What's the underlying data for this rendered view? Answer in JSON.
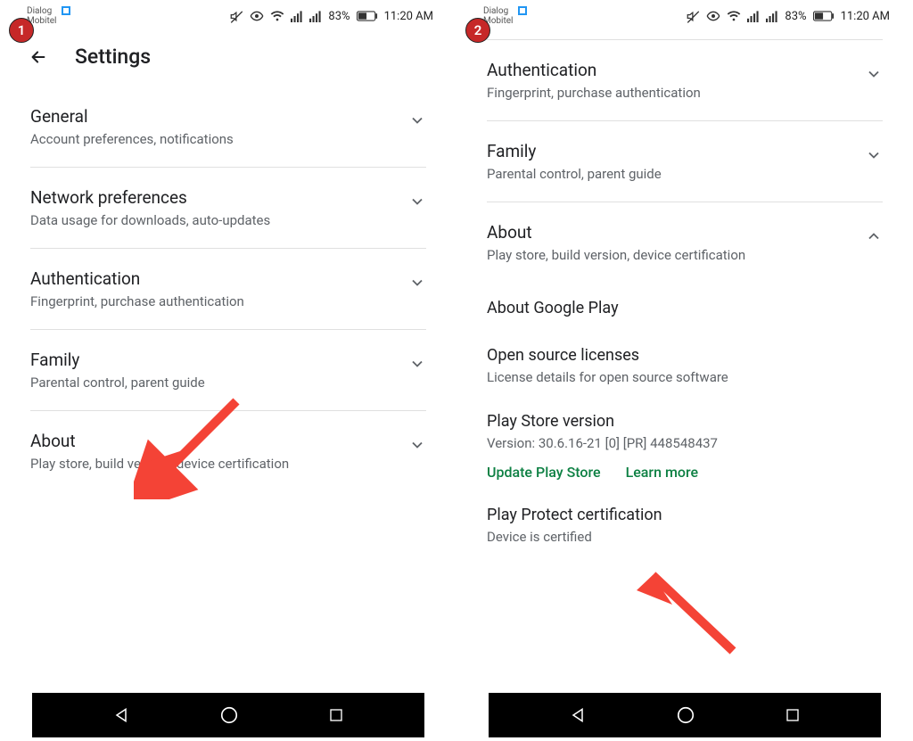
{
  "status": {
    "carrier1": "Dialog",
    "carrier2": "Mobitel",
    "battery": "83%",
    "time": "11:20 AM"
  },
  "screen1": {
    "badge": "1",
    "title": "Settings",
    "sections": [
      {
        "title": "General",
        "sub": "Account preferences, notifications"
      },
      {
        "title": "Network preferences",
        "sub": "Data usage for downloads, auto-updates"
      },
      {
        "title": "Authentication",
        "sub": "Fingerprint, purchase authentication"
      },
      {
        "title": "Family",
        "sub": "Parental control, parent guide"
      },
      {
        "title": "About",
        "sub": "Play store, build version, device certification"
      }
    ]
  },
  "screen2": {
    "badge": "2",
    "sections": [
      {
        "title": "Authentication",
        "sub": "Fingerprint, purchase authentication"
      },
      {
        "title": "Family",
        "sub": "Parental control, parent guide"
      },
      {
        "title": "About",
        "sub": "Play store, build version, device certification"
      }
    ],
    "about": {
      "item1": "About Google Play",
      "licenses_title": "Open source licenses",
      "licenses_sub": "License details for open source software",
      "version_title": "Play Store version",
      "version_sub": "Version: 30.6.16-21 [0] [PR] 448548437",
      "update": "Update Play Store",
      "learn": "Learn more",
      "protect_title": "Play Protect certification",
      "protect_sub": "Device is certified"
    }
  }
}
